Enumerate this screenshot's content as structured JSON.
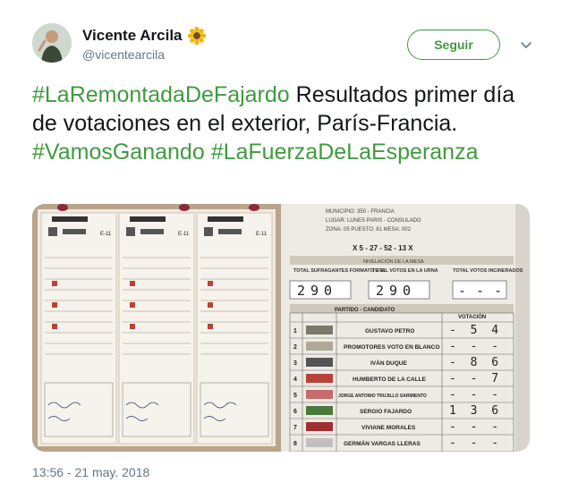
{
  "author": {
    "name": "Vicente Arcila",
    "handle": "@vicentearcila",
    "emoji_icon": "sunflower-icon"
  },
  "follow_button": {
    "label": "Seguir"
  },
  "tweet": {
    "segments": [
      {
        "text": "#LaRemontadaDeFajardo",
        "type": "hashtag"
      },
      {
        "text": " Resultados primer día de votaciones en el exterior, París-Francia. ",
        "type": "text"
      },
      {
        "text": "#VamosGanando",
        "type": "hashtag"
      },
      {
        "text": " ",
        "type": "text"
      },
      {
        "text": "#LaFuerzaDeLaEsperanza",
        "type": "hashtag"
      }
    ],
    "timestamp": "13:56 - 21 may. 2018"
  },
  "media": {
    "photo_left": {
      "form_headers": [
        "E-11",
        "E-11",
        "E-11"
      ]
    },
    "photo_right": {
      "top_lines": [
        "MUNICIPIO: 350 - FRANCIA",
        "LUGAR: LUNES PARIS - CONSULADO",
        "ZONA: 05   PUESTO: 81   MESA: 002"
      ],
      "code": "X  5 - 27 - 52 - 13  X",
      "section_title": "NIVELACIÓN DE LA MESA",
      "col1_label": "TOTAL SUFRAGANTES FORMATO E-11",
      "col1_value": "290",
      "col2_label": "TOTAL VOTOS EN LA URNA",
      "col2_value": "290",
      "col3_label": "TOTAL VOTOS INCINERADOS",
      "col3_value": "- - -",
      "table_header_party": "PARTIDO - CANDIDATO",
      "table_header_vote": "VOTACIÓN",
      "rows": [
        {
          "num": "1",
          "candidate": "GUSTAVO PETRO",
          "votes": "- 5 4"
        },
        {
          "num": "2",
          "candidate": "PROMOTORES VOTO EN BLANCO",
          "votes": "- - -"
        },
        {
          "num": "3",
          "candidate": "IVÁN DUQUE",
          "votes": "- 8 6"
        },
        {
          "num": "4",
          "candidate": "HUMBERTO DE LA CALLE",
          "votes": "- - 7"
        },
        {
          "num": "5",
          "candidate": "JORGE ANTONIO TRUJILLO SARMIENTO",
          "votes": "- - -"
        },
        {
          "num": "6",
          "candidate": "SERGIO FAJARDO",
          "votes": "1 3 6"
        },
        {
          "num": "7",
          "candidate": "VIVIANE MORALES",
          "votes": "- - -"
        },
        {
          "num": "8",
          "candidate": "GERMÁN VARGAS LLERAS",
          "votes": "- - -"
        }
      ]
    }
  }
}
